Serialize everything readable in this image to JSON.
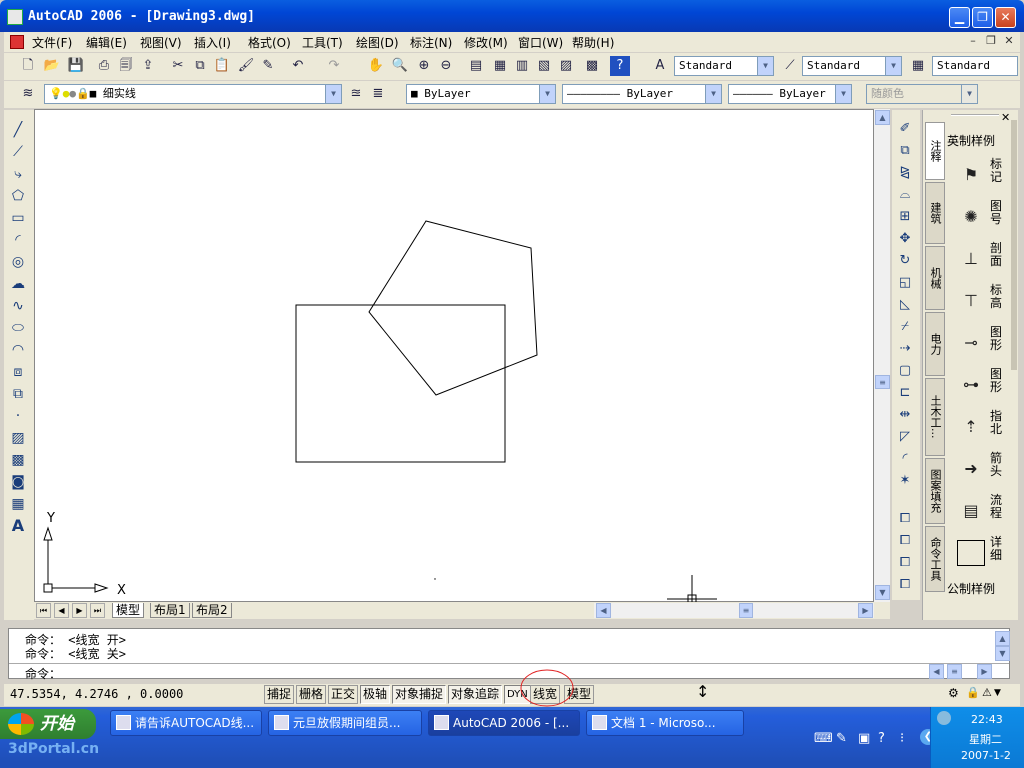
{
  "window": {
    "title": "AutoCAD 2006 - [Drawing3.dwg]",
    "min_icon": "minimize-icon",
    "max_icon": "maximize-icon",
    "close_icon": "close-icon"
  },
  "menubar": {
    "items": [
      "文件(F)",
      "编辑(E)",
      "视图(V)",
      "插入(I)",
      "格式(O)",
      "工具(T)",
      "绘图(D)",
      "标注(N)",
      "修改(M)",
      "窗口(W)",
      "帮助(H)"
    ]
  },
  "toolbar": {
    "text_style": "Standard",
    "dim_style": "Standard",
    "table_style": "Standard",
    "layer": "细实线",
    "color": "ByLayer",
    "linetype": "ByLayer",
    "lineweight": "ByLayer",
    "plot_style": "随颜色"
  },
  "canvas": {
    "ucs_x": "X",
    "ucs_y": "Y"
  },
  "layout_tabs": [
    "模型",
    "布局1",
    "布局2"
  ],
  "palette": {
    "tabs": [
      "注释",
      "建筑",
      "机械",
      "电力",
      "土木工...",
      "图案填充",
      "命令工具"
    ],
    "header": "英制样例",
    "items": [
      {
        "label": "标记",
        "icon": "tag-icon"
      },
      {
        "label": "图号",
        "icon": "callout-icon"
      },
      {
        "label": "剖面",
        "icon": "section-icon"
      },
      {
        "label": "标高",
        "icon": "elevation-icon"
      },
      {
        "label": "图形",
        "icon": "shape-icon"
      },
      {
        "label": "图形",
        "icon": "shape-icon"
      },
      {
        "label": "指北",
        "icon": "north-arrow-icon"
      },
      {
        "label": "箭头",
        "icon": "arrow-icon"
      },
      {
        "label": "流程",
        "icon": "flow-icon"
      },
      {
        "label": "详细",
        "icon": "detail-icon"
      }
    ],
    "footer": "公制样例"
  },
  "command": {
    "line1_prefix": "命令：",
    "line1": "<线宽 开>",
    "line2_prefix": "命令：",
    "line2": "<线宽 关>",
    "prompt": "命令："
  },
  "status": {
    "coords": "47.5354, 4.2746 , 0.0000",
    "toggles": [
      "捕捉",
      "栅格",
      "正交",
      "极轴",
      "对象捕捉",
      "对象追踪",
      "DYN",
      "线宽",
      "模型"
    ]
  },
  "taskbar": {
    "start": "开始",
    "buttons": [
      "请告诉AUTOCAD线...",
      "元旦放假期间组员...",
      "AutoCAD 2006 - [...",
      "文档 1 - Microso..."
    ],
    "time": "22:43",
    "weekday": "星期二",
    "date": "2007-1-2"
  },
  "watermark": "3dPortal.cn"
}
